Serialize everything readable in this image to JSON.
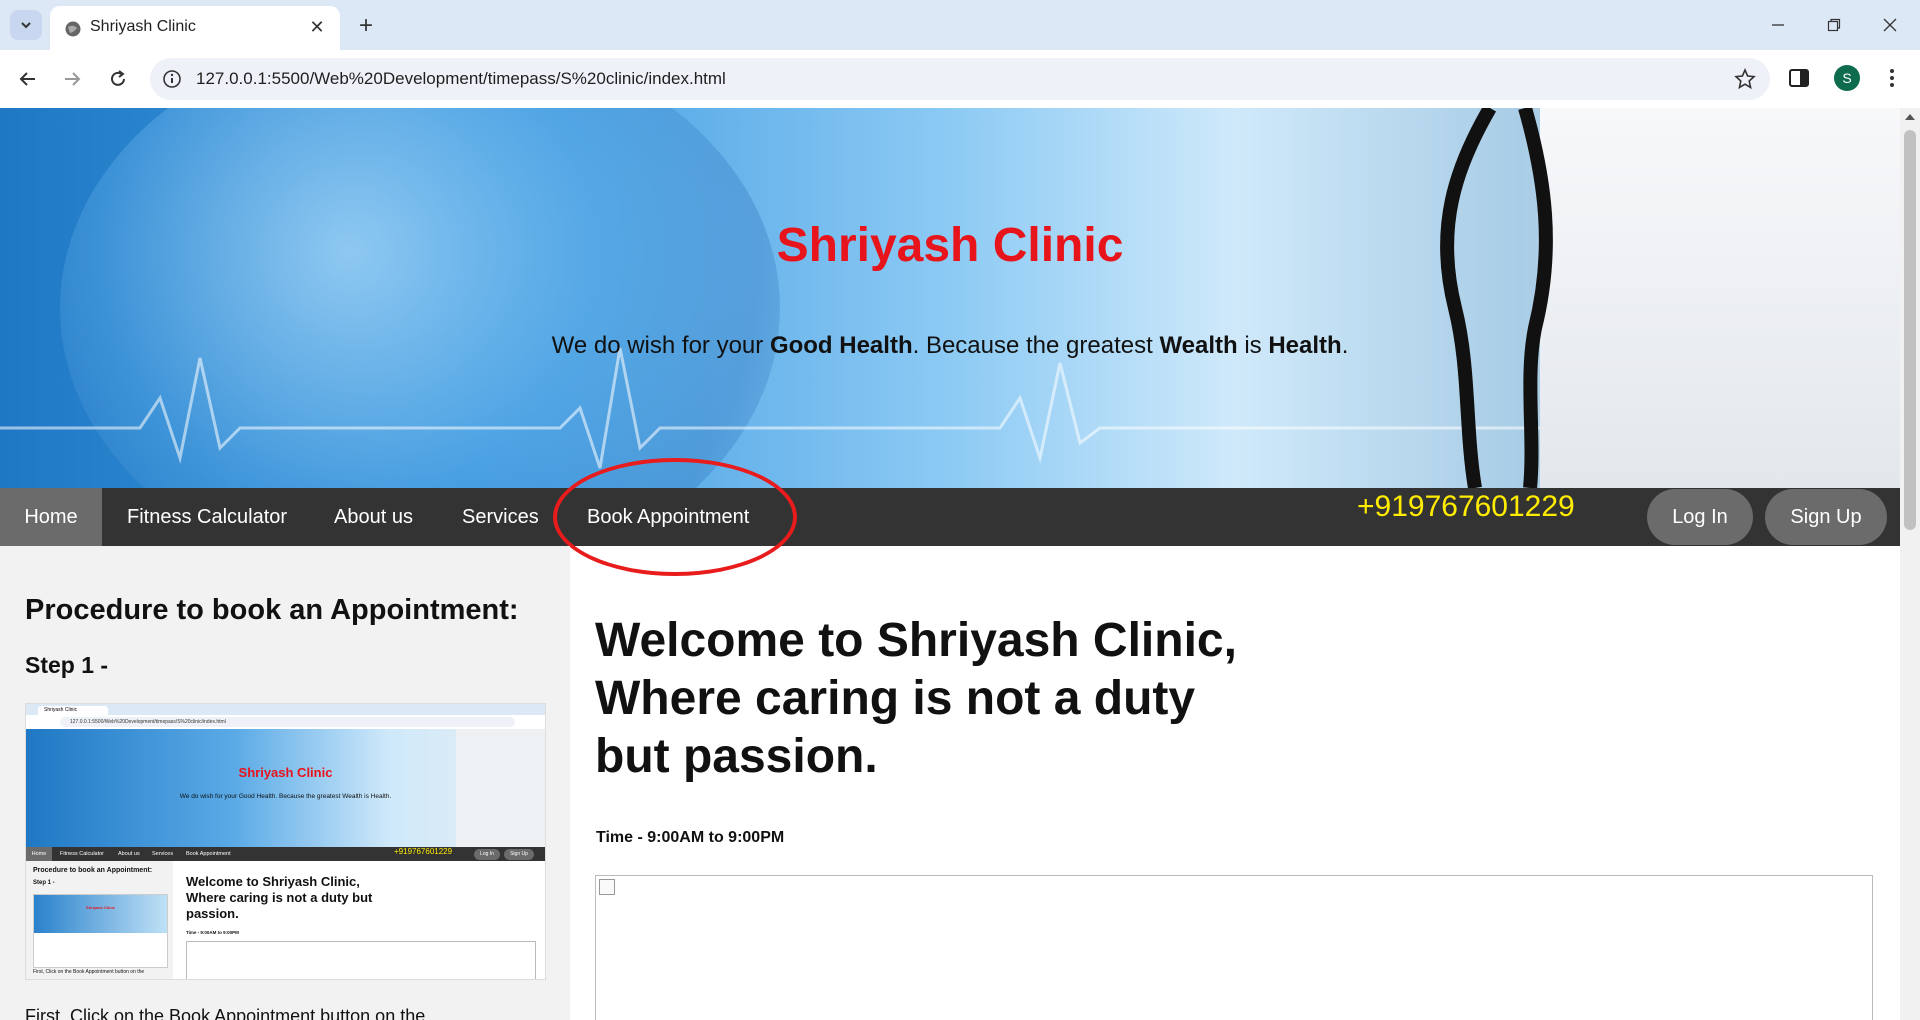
{
  "browser": {
    "tab_title": "Shriyash Clinic",
    "url": "127.0.0.1:5500/Web%20Development/timepass/S%20clinic/index.html",
    "profile_initial": "S"
  },
  "hero": {
    "title": "Shriyash Clinic",
    "tagline_parts": [
      "We do wish for your ",
      "Good Health",
      ". Because the greatest ",
      "Wealth",
      " is ",
      "Health",
      "."
    ]
  },
  "nav": {
    "items": [
      "Home",
      "Fitness Calculator",
      "About us",
      "Services",
      "Book Appointment"
    ],
    "phone": "+919767601229",
    "login": "Log In",
    "signup": "Sign Up"
  },
  "left": {
    "heading": "Procedure to book an Appointment:",
    "step": "Step 1 -",
    "text": "First, Click on the Book Appointment button on the"
  },
  "thumbnail": {
    "tab_title": "Shriyash Clinic",
    "url": "127.0.0.1:5500/Web%20Development/timepass/S%20clinic/index.html",
    "title": "Shriyash Clinic",
    "tagline": "We do wish for your Good Health. Because the greatest Wealth is Health.",
    "nav": [
      "Home",
      "Fitness Calculator",
      "About us",
      "Services",
      "Book Appointment"
    ],
    "phone": "+919767601229",
    "login": "Log In",
    "signup": "Sign Up",
    "proc": "Procedure to book an Appointment:",
    "step": "Step 1 -",
    "mini_title": "Shriyash Clinic",
    "first": "First, Click on the Book Appointment button on the",
    "welcome": "Welcome to Shriyash Clinic, Where caring is not a duty but passion.",
    "time": "Time - 9:00AM to 9:00PM"
  },
  "main": {
    "welcome_lines": [
      "Welcome to Shriyash Clinic,",
      "Where caring is not a duty",
      "but passion."
    ],
    "time": "Time - 9:00AM to 9:00PM"
  },
  "colors": {
    "brand_red": "#e8141b",
    "nav_bg": "#333333",
    "phone_yellow": "#ffec00",
    "annotation_red": "#e81c1c"
  }
}
